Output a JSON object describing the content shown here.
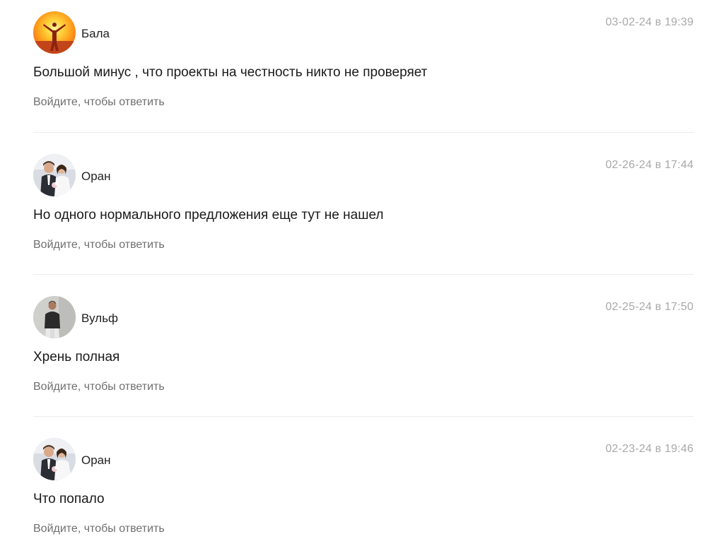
{
  "comments": [
    {
      "author": "Бала",
      "date": "03-02-24 в 19:39",
      "text": "Большой минус , что проекты на честность никто не проверяет",
      "reply_label": "Войдите, чтобы ответить",
      "avatar": "sunset-person-avatar"
    },
    {
      "author": "Оран",
      "date": "02-26-24 в 17:44",
      "text": "Но одного нормального предложения еще тут не нашел",
      "reply_label": "Войдите, чтобы ответить",
      "avatar": "wedding-couple-avatar"
    },
    {
      "author": "Вульф",
      "date": "02-25-24 в 17:50",
      "text": "Хрень полная",
      "reply_label": "Войдите, чтобы ответить",
      "avatar": "man-portrait-avatar"
    },
    {
      "author": "Оран",
      "date": "02-23-24 в 19:46",
      "text": "Что попало",
      "reply_label": "Войдите, чтобы ответить",
      "avatar": "wedding-couple-avatar"
    }
  ],
  "colors": {
    "date": "#a9a9a9",
    "reply": "#6f6f6f",
    "divider": "#ececec"
  }
}
